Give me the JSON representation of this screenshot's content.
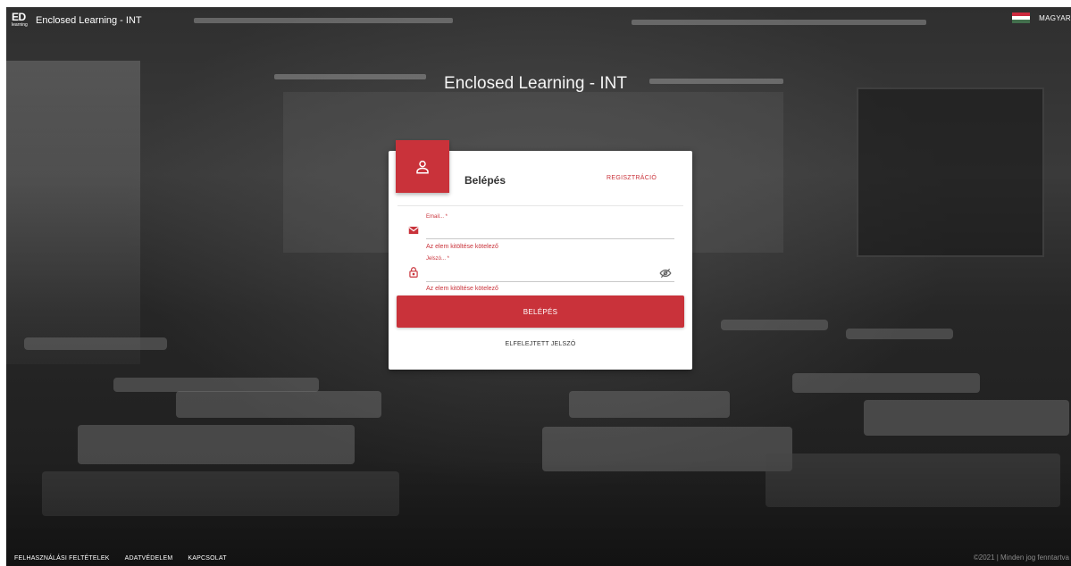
{
  "header": {
    "logo_big": "ED",
    "logo_small": "learning",
    "app_title": "Enclosed Learning - INT",
    "language_label": "MAGYAR",
    "flag_colors": [
      "#cd2a3e",
      "#ffffff",
      "#436f4d"
    ]
  },
  "hero": {
    "title": "Enclosed Learning - INT"
  },
  "login_card": {
    "title": "Belépés",
    "register_link": "REGISZTRÁCIÓ",
    "email": {
      "label": "Email... *",
      "value": "",
      "error": "Az elem kitöltése kötelező"
    },
    "password": {
      "label": "Jelszó... *",
      "value": "",
      "error": "Az elem kitöltése kötelező"
    },
    "submit_label": "BELÉPÉS",
    "forgot_password": "ELFELEJTETT JELSZÓ",
    "accent_color": "#c9323a"
  },
  "footer": {
    "links": [
      {
        "label": "FELHASZNÁLÁSI FELTÉTELEK"
      },
      {
        "label": "ADATVÉDELEM"
      },
      {
        "label": "KAPCSOLAT"
      }
    ],
    "copyright": "©2021 | Minden jog fenntartva"
  }
}
